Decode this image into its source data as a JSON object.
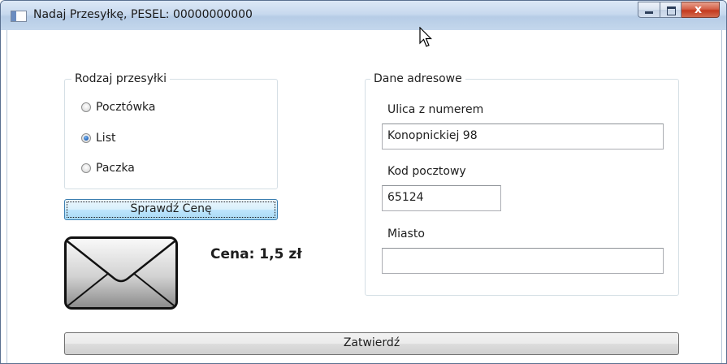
{
  "window": {
    "title": "Nadaj Przesyłkę, PESEL: 00000000000",
    "close_glyph": "x"
  },
  "shipment_type": {
    "legend": "Rodzaj przesyłki",
    "options": [
      {
        "label": "Pocztówka",
        "checked": false
      },
      {
        "label": "List",
        "checked": true
      },
      {
        "label": "Paczka",
        "checked": false
      }
    ],
    "selected": "List"
  },
  "check_price_button": "Sprawdź Cenę",
  "envelope_icon": "envelope-icon",
  "price_label": "Cena: 1,5 zł",
  "address": {
    "legend": "Dane adresowe",
    "street_label": "Ulica z numerem",
    "street_value": "Konopnickiej 98",
    "postal_label": "Kod pocztowy",
    "postal_value": "65124",
    "city_label": "Miasto",
    "city_value": ""
  },
  "confirm_button": "Zatwierdź",
  "colors": {
    "titlebar": "#c7d9ee",
    "close_button": "#c4391d",
    "focused_button": "#bee6fd",
    "group_border": "#d5dfe5"
  }
}
